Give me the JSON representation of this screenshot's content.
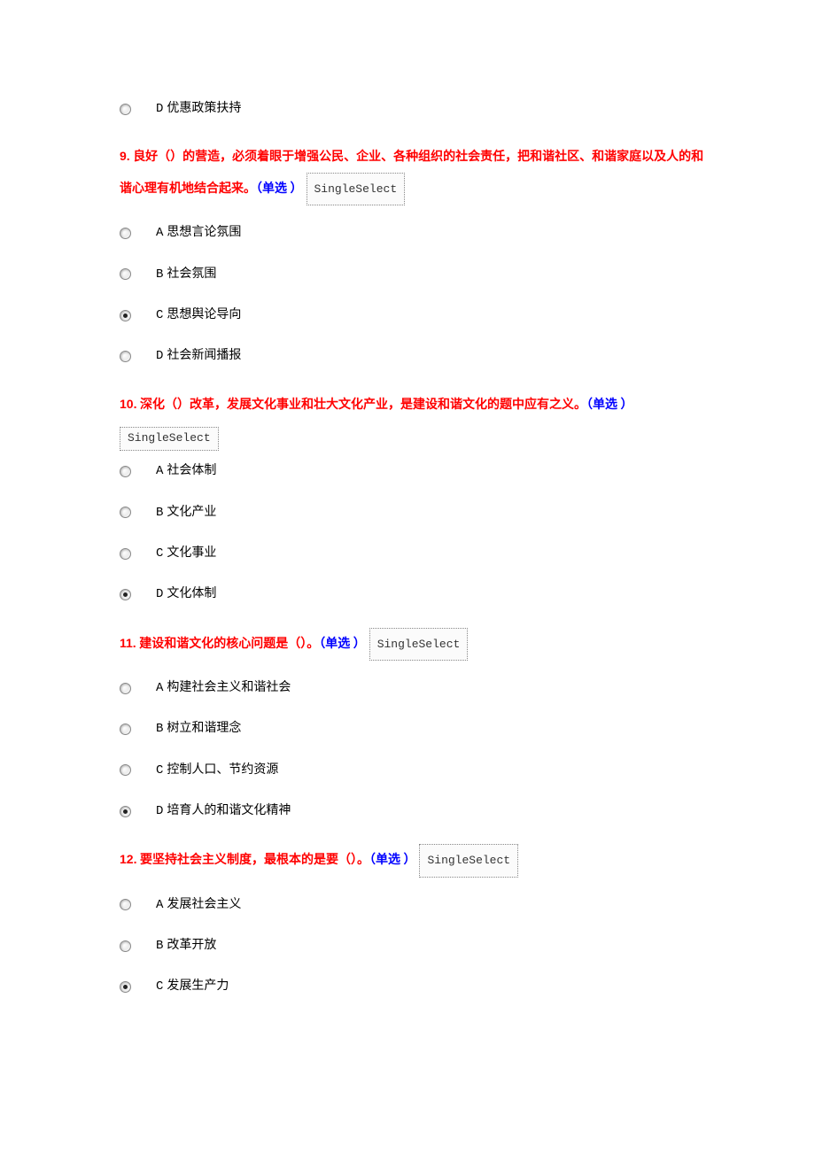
{
  "badge": "SingleSelect",
  "orphanOption": {
    "letter": "D",
    "text": "优惠政策扶持",
    "checked": false
  },
  "questions": [
    {
      "num": "9.",
      "text": " 良好（）的营造，必须着眼于增强公民、企业、各种组织的社会责任，把和谐社区、和谐家庭以及人的和谐心理有机地结合起来。",
      "hint": "（单选 ）",
      "badgeInline": true,
      "options": [
        {
          "letter": "A",
          "text": "思想言论氛围",
          "checked": false
        },
        {
          "letter": "B",
          "text": "社会氛围",
          "checked": false
        },
        {
          "letter": "C",
          "text": "思想舆论导向",
          "checked": true
        },
        {
          "letter": "D",
          "text": "社会新闻播报",
          "checked": false
        }
      ]
    },
    {
      "num": "10.",
      "text": " 深化（）改革，发展文化事业和壮大文化产业，是建设和谐文化的题中应有之义。",
      "hint": "（单选 ）",
      "badgeInline": false,
      "options": [
        {
          "letter": "A",
          "text": "社会体制",
          "checked": false
        },
        {
          "letter": "B",
          "text": "文化产业",
          "checked": false
        },
        {
          "letter": "C",
          "text": "文化事业",
          "checked": false
        },
        {
          "letter": "D",
          "text": "文化体制",
          "checked": true
        }
      ]
    },
    {
      "num": "11.",
      "text": " 建设和谐文化的核心问题是（）。",
      "hint": "（单选 ）",
      "badgeInline": true,
      "options": [
        {
          "letter": "A",
          "text": "构建社会主义和谐社会",
          "checked": false
        },
        {
          "letter": "B",
          "text": "树立和谐理念",
          "checked": false
        },
        {
          "letter": "C",
          "text": "控制人口、节约资源",
          "checked": false
        },
        {
          "letter": "D",
          "text": "培育人的和谐文化精神",
          "checked": true
        }
      ]
    },
    {
      "num": "12.",
      "text": " 要坚持社会主义制度，最根本的是要（）。",
      "hint": "（单选 ）",
      "badgeInline": true,
      "options": [
        {
          "letter": "A",
          "text": "发展社会主义",
          "checked": false
        },
        {
          "letter": "B",
          "text": "改革开放",
          "checked": false
        },
        {
          "letter": "C",
          "text": "发展生产力",
          "checked": true
        }
      ]
    }
  ]
}
